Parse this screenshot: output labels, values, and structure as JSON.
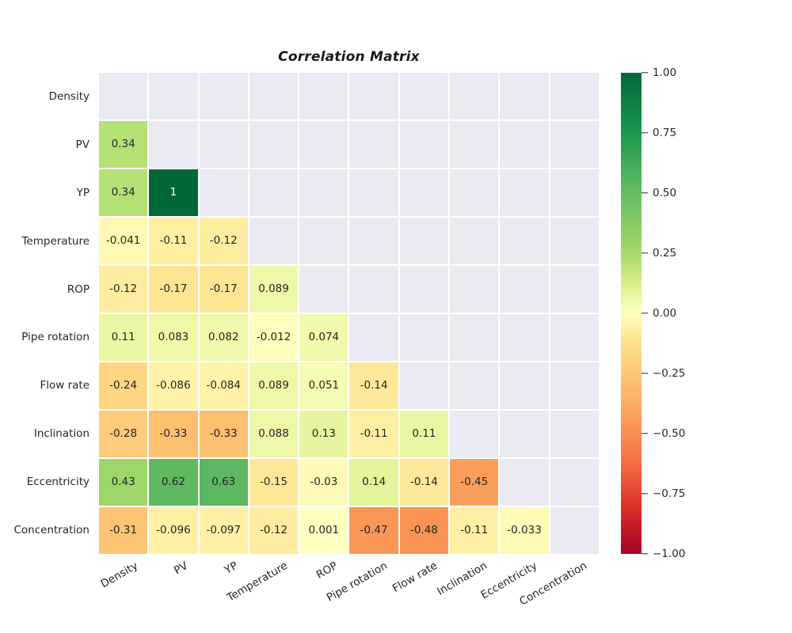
{
  "chart_data": {
    "type": "heatmap",
    "title": "Correlation Matrix",
    "xlabel": "",
    "ylabel": "",
    "grid": false,
    "mask": "lower-triangle-shown (upper triangle including diagonal blank)",
    "colormap": "RdYlGn",
    "colorbar": {
      "position": "right",
      "vmin": -1.0,
      "vmax": 1.0,
      "ticks": [
        "1.00",
        "0.75",
        "0.50",
        "0.25",
        "0.00",
        "−0.25",
        "−0.50",
        "−0.75",
        "−1.00"
      ],
      "tick_values": [
        1.0,
        0.75,
        0.5,
        0.25,
        0.0,
        -0.25,
        -0.5,
        -0.75,
        -1.0
      ]
    },
    "categories": [
      "Density",
      "PV",
      "YP",
      "Temperature",
      "ROP",
      "Pipe rotation",
      "Flow rate",
      "Inclination",
      "Eccentricity",
      "Concentration"
    ],
    "x_tick_labels": [
      "Density",
      "PV",
      "YP",
      "Temperature",
      "ROP",
      "Pipe rotation",
      "Flow rate",
      "Inclination",
      "Eccentricity",
      "Concentration"
    ],
    "y_tick_labels": [
      "Density",
      "PV",
      "YP",
      "Temperature",
      "ROP",
      "Pipe rotation",
      "Flow rate",
      "Inclination",
      "Eccentricity",
      "Concentration"
    ],
    "annotation_format": "2 significant digits",
    "rows": [
      {
        "label": "Density",
        "cells": [
          {
            "text": "",
            "value": null
          },
          {
            "text": "",
            "value": null
          },
          {
            "text": "",
            "value": null
          },
          {
            "text": "",
            "value": null
          },
          {
            "text": "",
            "value": null
          },
          {
            "text": "",
            "value": null
          },
          {
            "text": "",
            "value": null
          },
          {
            "text": "",
            "value": null
          },
          {
            "text": "",
            "value": null
          },
          {
            "text": "",
            "value": null
          }
        ]
      },
      {
        "label": "PV",
        "cells": [
          {
            "text": "0.34",
            "value": 0.34
          },
          {
            "text": "",
            "value": null
          },
          {
            "text": "",
            "value": null
          },
          {
            "text": "",
            "value": null
          },
          {
            "text": "",
            "value": null
          },
          {
            "text": "",
            "value": null
          },
          {
            "text": "",
            "value": null
          },
          {
            "text": "",
            "value": null
          },
          {
            "text": "",
            "value": null
          },
          {
            "text": "",
            "value": null
          }
        ]
      },
      {
        "label": "YP",
        "cells": [
          {
            "text": "0.34",
            "value": 0.34
          },
          {
            "text": "1",
            "value": 1.0
          },
          {
            "text": "",
            "value": null
          },
          {
            "text": "",
            "value": null
          },
          {
            "text": "",
            "value": null
          },
          {
            "text": "",
            "value": null
          },
          {
            "text": "",
            "value": null
          },
          {
            "text": "",
            "value": null
          },
          {
            "text": "",
            "value": null
          },
          {
            "text": "",
            "value": null
          }
        ]
      },
      {
        "label": "Temperature",
        "cells": [
          {
            "text": "-0.041",
            "value": -0.041
          },
          {
            "text": "-0.11",
            "value": -0.11
          },
          {
            "text": "-0.12",
            "value": -0.12
          },
          {
            "text": "",
            "value": null
          },
          {
            "text": "",
            "value": null
          },
          {
            "text": "",
            "value": null
          },
          {
            "text": "",
            "value": null
          },
          {
            "text": "",
            "value": null
          },
          {
            "text": "",
            "value": null
          },
          {
            "text": "",
            "value": null
          }
        ]
      },
      {
        "label": "ROP",
        "cells": [
          {
            "text": "-0.12",
            "value": -0.12
          },
          {
            "text": "-0.17",
            "value": -0.17
          },
          {
            "text": "-0.17",
            "value": -0.17
          },
          {
            "text": "0.089",
            "value": 0.089
          },
          {
            "text": "",
            "value": null
          },
          {
            "text": "",
            "value": null
          },
          {
            "text": "",
            "value": null
          },
          {
            "text": "",
            "value": null
          },
          {
            "text": "",
            "value": null
          },
          {
            "text": "",
            "value": null
          }
        ]
      },
      {
        "label": "Pipe rotation",
        "cells": [
          {
            "text": "0.11",
            "value": 0.11
          },
          {
            "text": "0.083",
            "value": 0.083
          },
          {
            "text": "0.082",
            "value": 0.082
          },
          {
            "text": "-0.012",
            "value": -0.012
          },
          {
            "text": "0.074",
            "value": 0.074
          },
          {
            "text": "",
            "value": null
          },
          {
            "text": "",
            "value": null
          },
          {
            "text": "",
            "value": null
          },
          {
            "text": "",
            "value": null
          },
          {
            "text": "",
            "value": null
          }
        ]
      },
      {
        "label": "Flow rate",
        "cells": [
          {
            "text": "-0.24",
            "value": -0.24
          },
          {
            "text": "-0.086",
            "value": -0.086
          },
          {
            "text": "-0.084",
            "value": -0.084
          },
          {
            "text": "0.089",
            "value": 0.089
          },
          {
            "text": "0.051",
            "value": 0.051
          },
          {
            "text": "-0.14",
            "value": -0.14
          },
          {
            "text": "",
            "value": null
          },
          {
            "text": "",
            "value": null
          },
          {
            "text": "",
            "value": null
          },
          {
            "text": "",
            "value": null
          }
        ]
      },
      {
        "label": "Inclination",
        "cells": [
          {
            "text": "-0.28",
            "value": -0.28
          },
          {
            "text": "-0.33",
            "value": -0.33
          },
          {
            "text": "-0.33",
            "value": -0.33
          },
          {
            "text": "0.088",
            "value": 0.088
          },
          {
            "text": "0.13",
            "value": 0.13
          },
          {
            "text": "-0.11",
            "value": -0.11
          },
          {
            "text": "0.11",
            "value": 0.11
          },
          {
            "text": "",
            "value": null
          },
          {
            "text": "",
            "value": null
          },
          {
            "text": "",
            "value": null
          }
        ]
      },
      {
        "label": "Eccentricity",
        "cells": [
          {
            "text": "0.43",
            "value": 0.43
          },
          {
            "text": "0.62",
            "value": 0.62
          },
          {
            "text": "0.63",
            "value": 0.63
          },
          {
            "text": "-0.15",
            "value": -0.15
          },
          {
            "text": "-0.03",
            "value": -0.03
          },
          {
            "text": "0.14",
            "value": 0.14
          },
          {
            "text": "-0.14",
            "value": -0.14
          },
          {
            "text": "-0.45",
            "value": -0.45
          },
          {
            "text": "",
            "value": null
          },
          {
            "text": "",
            "value": null
          }
        ]
      },
      {
        "label": "Concentration",
        "cells": [
          {
            "text": "-0.31",
            "value": -0.31
          },
          {
            "text": "-0.096",
            "value": -0.096
          },
          {
            "text": "-0.097",
            "value": -0.097
          },
          {
            "text": "-0.12",
            "value": -0.12
          },
          {
            "text": "0.001",
            "value": 0.001
          },
          {
            "text": "-0.47",
            "value": -0.47
          },
          {
            "text": "-0.48",
            "value": -0.48
          },
          {
            "text": "-0.11",
            "value": -0.11
          },
          {
            "text": "-0.033",
            "value": -0.033
          },
          {
            "text": "",
            "value": null
          }
        ]
      }
    ],
    "colors": {
      "empty_cell": "#e9e9f2",
      "background": "#ffffff",
      "text": "#262626",
      "cmap_min": "#a50026",
      "cmap_mid": "#ffffbf",
      "cmap_max": "#006837"
    }
  }
}
